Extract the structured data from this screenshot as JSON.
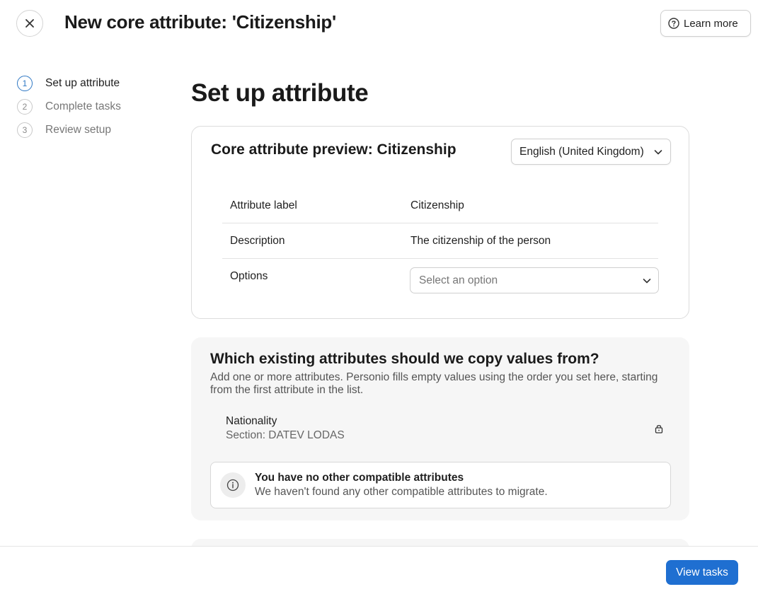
{
  "header": {
    "title": "New core attribute: 'Citizenship'",
    "learn_more_label": "Learn more"
  },
  "steps": [
    {
      "number": "1",
      "label": "Set up attribute",
      "active": true
    },
    {
      "number": "2",
      "label": "Complete tasks",
      "active": false
    },
    {
      "number": "3",
      "label": "Review setup",
      "active": false
    }
  ],
  "main": {
    "title": "Set up attribute"
  },
  "preview": {
    "title": "Core attribute preview: Citizenship",
    "language": "English (United Kingdom)",
    "rows": [
      {
        "label": "Attribute label",
        "value": "Citizenship"
      },
      {
        "label": "Description",
        "value": "The citizenship of the person"
      },
      {
        "label": "Options",
        "placeholder": "Select an option"
      }
    ]
  },
  "copy": {
    "title": "Which existing attributes should we copy values from?",
    "description": "Add one or more attributes. Personio fills empty values using the order you set here, starting from the first attribute in the list.",
    "attribute_name": "Nationality",
    "attribute_section": "Section: DATEV LODAS",
    "info_title": "You have no other compatible attributes",
    "info_description": "We haven't found any other compatible attributes to migrate."
  },
  "footer": {
    "view_tasks_label": "View tasks"
  },
  "colors": {
    "accent": "#1f6fd1",
    "step_active": "#2f78c4"
  }
}
